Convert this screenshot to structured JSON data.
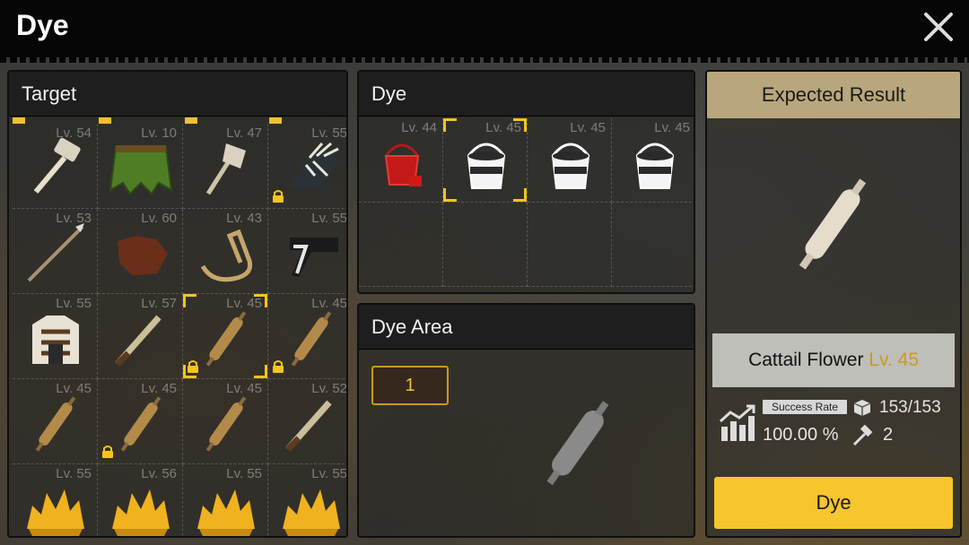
{
  "window": {
    "title": "Dye",
    "close_icon": "close-icon"
  },
  "target": {
    "header": "Target",
    "items": [
      {
        "level": "Lv. 54",
        "icon": "hammer-icon",
        "locked": false
      },
      {
        "level": "Lv. 10",
        "icon": "leaf-skirt-icon",
        "locked": false
      },
      {
        "level": "Lv. 47",
        "icon": "axe-icon",
        "locked": false
      },
      {
        "level": "Lv. 55",
        "icon": "skeletal-glove-icon",
        "locked": true
      },
      {
        "level": "Lv. 53",
        "icon": "spear-icon",
        "locked": false
      },
      {
        "level": "Lv. 60",
        "icon": "leather-hide-icon",
        "locked": false
      },
      {
        "level": "Lv. 43",
        "icon": "rope-icon",
        "locked": false
      },
      {
        "level": "Lv. 55",
        "icon": "bandana-icon",
        "locked": false
      },
      {
        "level": "Lv. 55",
        "icon": "armor-vest-icon",
        "locked": false
      },
      {
        "level": "Lv. 57",
        "icon": "blade-icon",
        "locked": false
      },
      {
        "level": "Lv. 45",
        "icon": "cattail-flower-icon",
        "locked": true
      },
      {
        "level": "Lv. 45",
        "icon": "cattail-flower-icon",
        "locked": true
      },
      {
        "level": "Lv. 45",
        "icon": "cattail-flower-icon",
        "locked": false
      },
      {
        "level": "Lv. 45",
        "icon": "cattail-flower-icon",
        "locked": true
      },
      {
        "level": "Lv. 45",
        "icon": "cattail-flower-icon",
        "locked": false
      },
      {
        "level": "Lv. 52",
        "icon": "blade-icon",
        "locked": false
      },
      {
        "level": "Lv. 55",
        "icon": "hay-bundle-icon",
        "locked": false
      },
      {
        "level": "Lv. 56",
        "icon": "hay-bundle-icon",
        "locked": false
      },
      {
        "level": "Lv. 55",
        "icon": "hay-bundle-icon",
        "locked": false
      },
      {
        "level": "Lv. 55",
        "icon": "hay-bundle-icon",
        "locked": false
      }
    ]
  },
  "dye": {
    "header": "Dye",
    "items": [
      {
        "level": "Lv. 44",
        "icon": "red-dye-bucket-icon"
      },
      {
        "level": "Lv. 45",
        "icon": "white-dye-bucket-icon"
      },
      {
        "level": "Lv. 45",
        "icon": "white-dye-bucket-icon"
      },
      {
        "level": "Lv. 45",
        "icon": "white-dye-bucket-icon"
      }
    ]
  },
  "dye_area": {
    "header": "Dye Area",
    "count": "1"
  },
  "result": {
    "header": "Expected Result",
    "name": "Cattail Flower",
    "level": "Lv. 45",
    "success_label": "Success Rate",
    "success_rate": "100.00 %",
    "stock": "153/153",
    "tool_count": "2",
    "button": "Dye"
  },
  "colors": {
    "accent": "#f7c52e",
    "selected_border": "#f5c518",
    "header_bg": "#b9a67c"
  }
}
